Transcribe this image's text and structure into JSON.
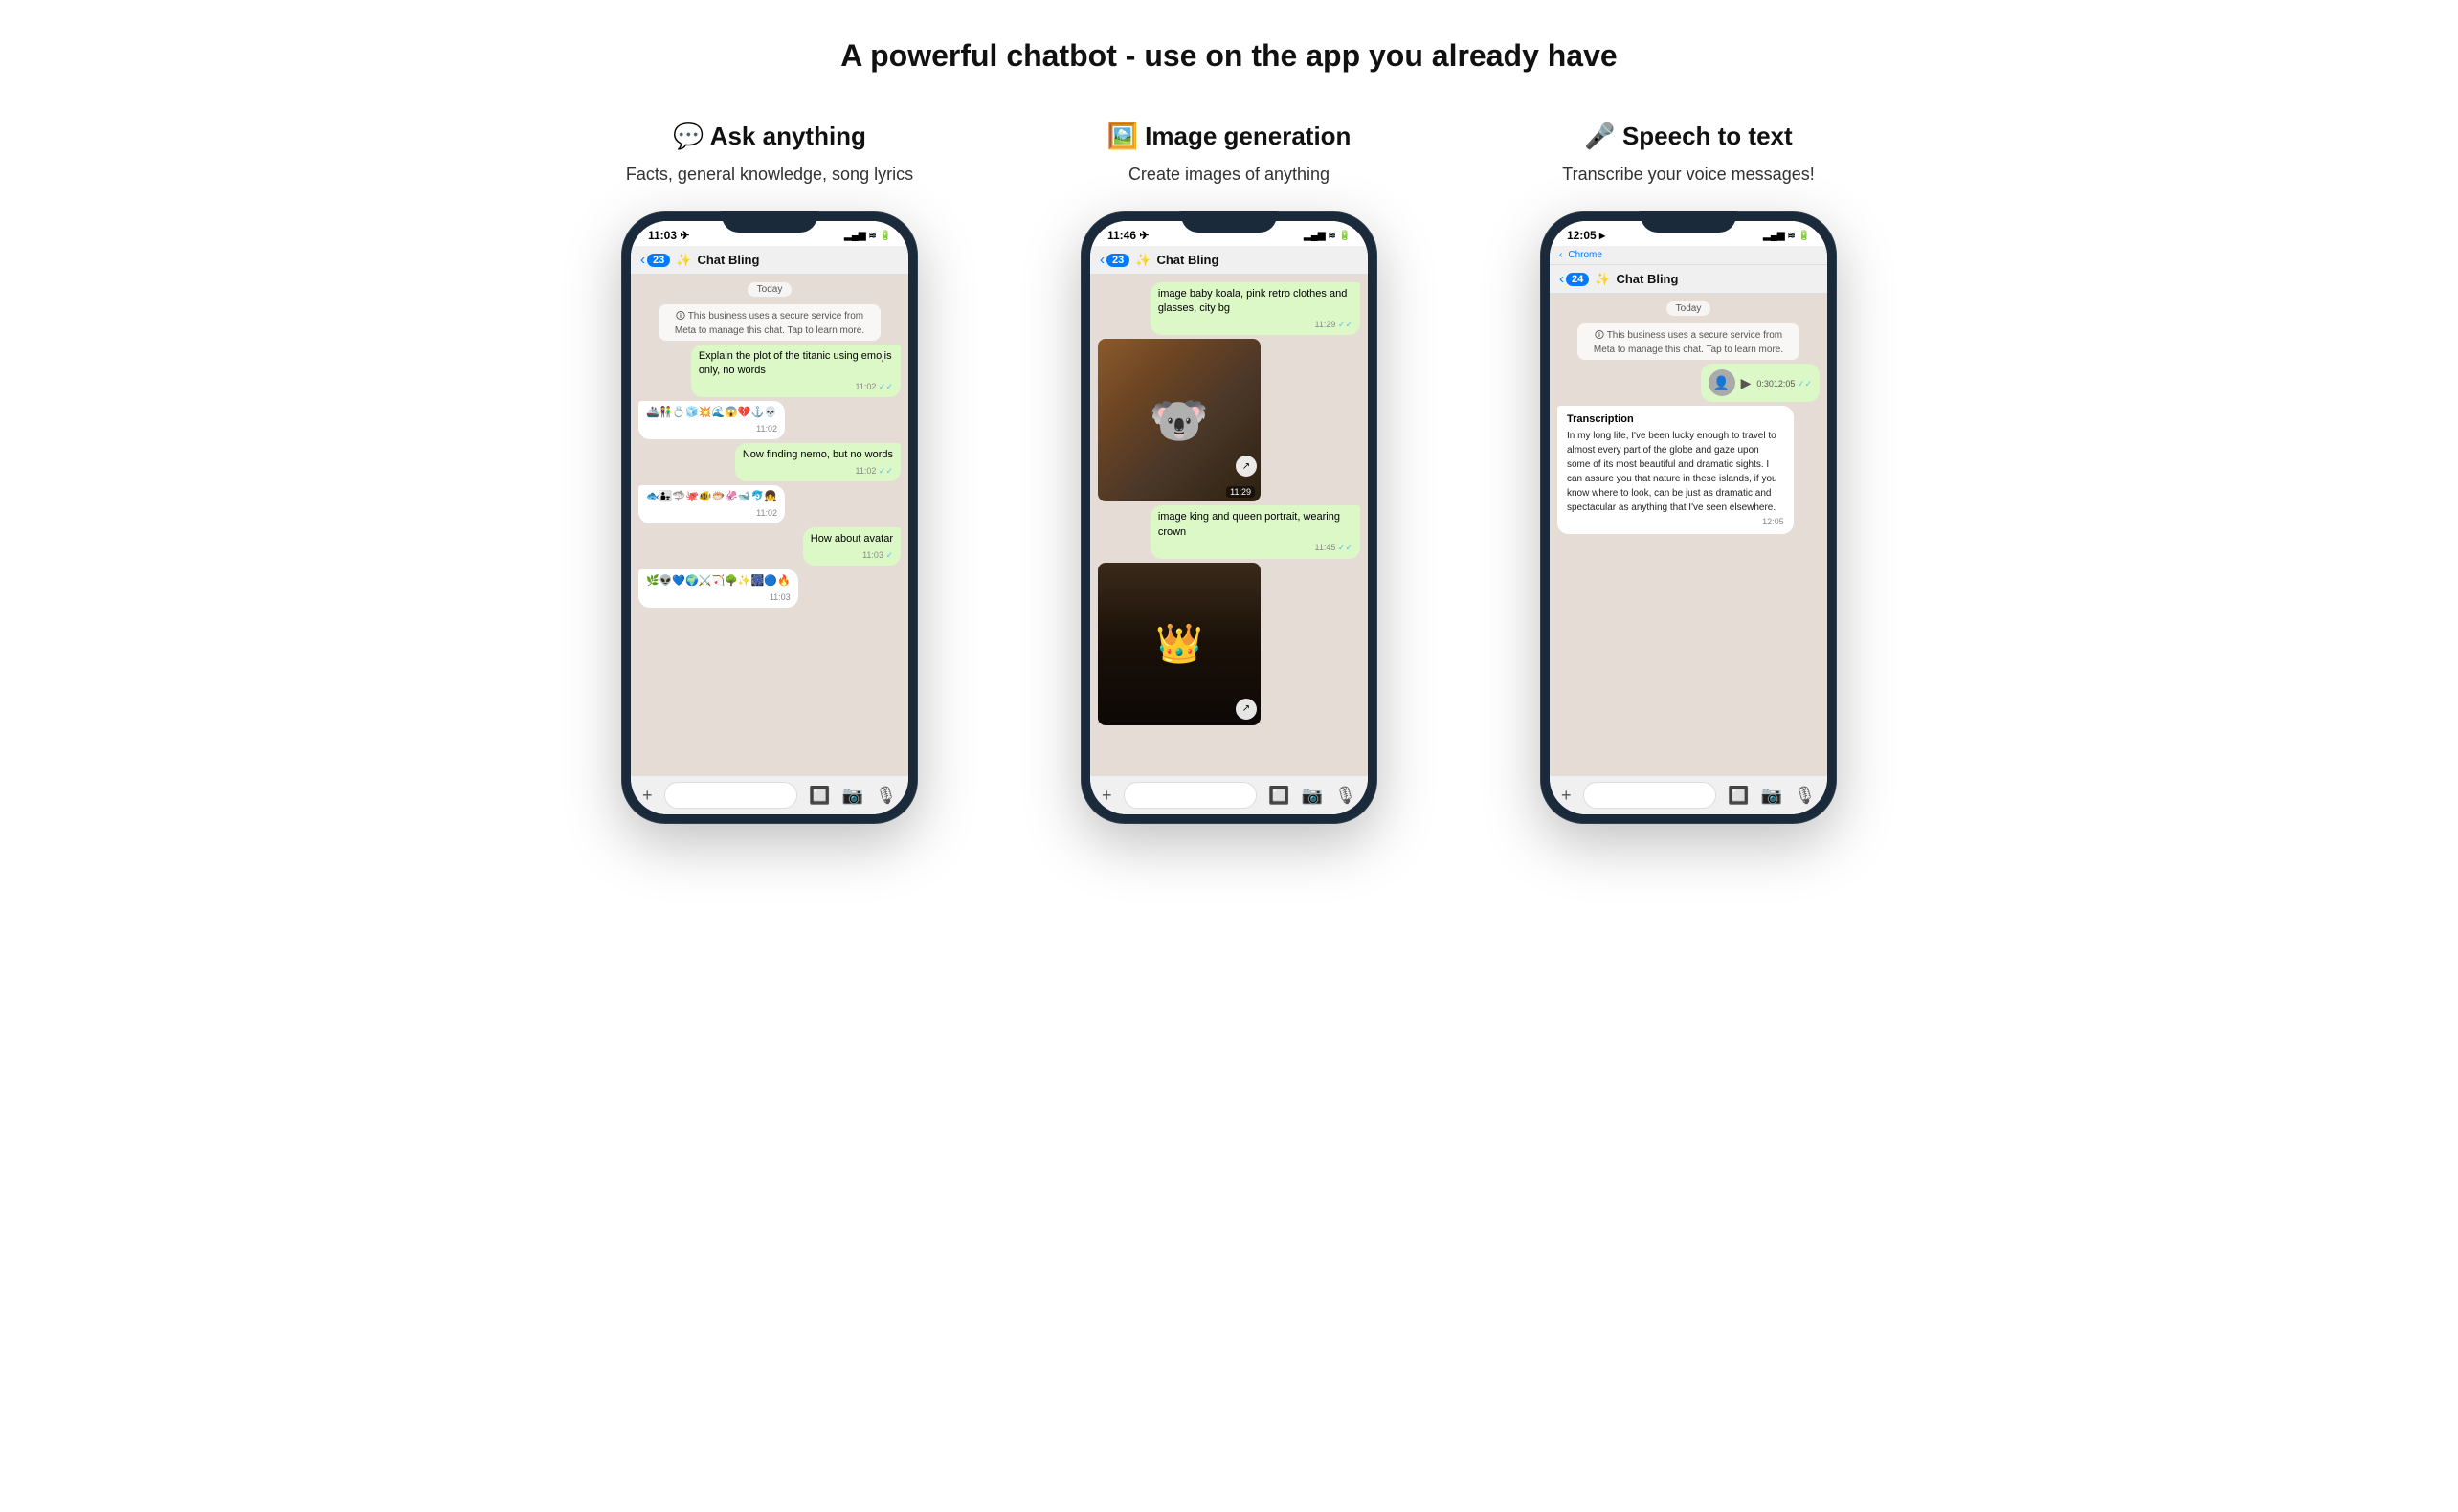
{
  "page": {
    "title": "A powerful chatbot - use on the app you already have"
  },
  "columns": [
    {
      "id": "ask",
      "icon": "💬",
      "title": "Ask anything",
      "subtitle": "Facts, general knowledge, song lyrics",
      "phone": {
        "time": "11:03",
        "location_icon": "✈",
        "chrome_bar": null,
        "header": {
          "back_num": "23",
          "name": "Chat Bling"
        },
        "messages": [
          {
            "type": "date",
            "text": "Today"
          },
          {
            "type": "system",
            "text": "🛈 This business uses a secure service from Meta to manage this chat. Tap to learn more."
          },
          {
            "type": "sent",
            "text": "Explain the plot of the titanic using emojis only, no words",
            "time": "11:02",
            "check": "✓✓"
          },
          {
            "type": "received",
            "text": "🚢👫💍🧊💥🌊😱💔⚓💀🥶",
            "time": "11:02"
          },
          {
            "type": "sent",
            "text": "Now finding nemo, but no words",
            "time": "11:02",
            "check": "✓✓"
          },
          {
            "type": "received",
            "text": "🐟👨‍👧🦈🐙🐠🐡🦑🐋🐬👧🏊",
            "time": "11:02"
          },
          {
            "type": "sent",
            "text": "How about avatar",
            "time": "11:03",
            "check": "✓✓"
          },
          {
            "type": "received",
            "text": "🌿👽💙🌍⚔️🏹🌳✨🎆🔵🔥",
            "time": "11:03"
          }
        ]
      }
    },
    {
      "id": "image",
      "icon": "🖼️",
      "title": "Image generation",
      "subtitle": "Create images of anything",
      "phone": {
        "time": "11:46",
        "location_icon": "✈",
        "chrome_bar": null,
        "header": {
          "back_num": "23",
          "name": "Chat Bling"
        },
        "messages": [
          {
            "type": "sent",
            "text": "image baby koala, pink retro clothes and glasses, city bg",
            "time": "11:29",
            "check": "✓✓"
          },
          {
            "type": "img_koala",
            "time": "11:29"
          },
          {
            "type": "sent",
            "text": "image king and queen portrait, wearing crown",
            "time": "11:45",
            "check": "✓✓"
          },
          {
            "type": "img_king"
          }
        ]
      }
    },
    {
      "id": "speech",
      "icon": "🎤",
      "title": "Speech to text",
      "subtitle": "Transcribe your voice messages!",
      "phone": {
        "time": "12:05",
        "location_icon": "▸",
        "chrome_bar": "Chrome",
        "header": {
          "back_num": "24",
          "name": "Chat Bling"
        },
        "messages": [
          {
            "type": "date",
            "text": "Today"
          },
          {
            "type": "system",
            "text": "🛈 This business uses a secure service from Meta to manage this chat. Tap to learn more."
          },
          {
            "type": "voice",
            "duration": "0:30",
            "time": "12:05"
          },
          {
            "type": "transcript",
            "title": "Transcription",
            "text": "In my long life, I've been lucky enough to travel to almost every part of the globe and gaze upon some of its most beautiful and dramatic sights. I can assure you that nature in these islands, if you know where to look, can be just as dramatic and spectacular as anything that I've seen elsewhere.",
            "time": "12:05"
          }
        ]
      }
    }
  ]
}
